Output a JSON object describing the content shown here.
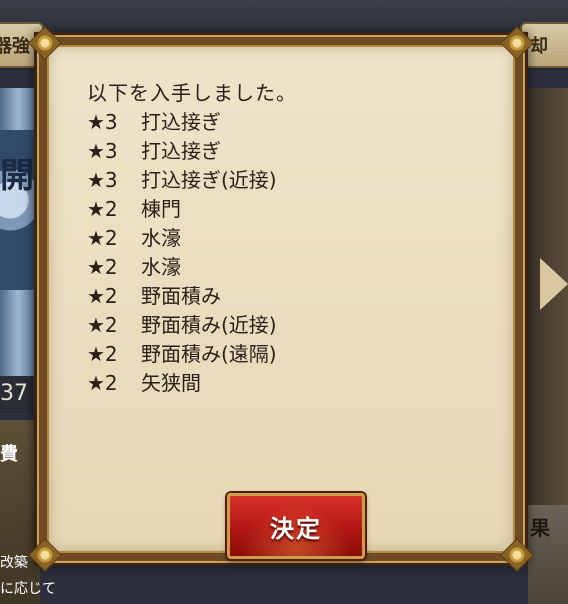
{
  "background": {
    "top_left_tab": "器強",
    "top_right_tab": "却",
    "left_glyph": "開",
    "left_number": "37",
    "left_text_1": "費",
    "left_text_2": "改築",
    "left_text_3": "に応じて",
    "right_text": "果"
  },
  "dialog": {
    "message": "以下を入手しました。",
    "items": [
      {
        "rarity": "★3",
        "name": "打込接ぎ"
      },
      {
        "rarity": "★3",
        "name": "打込接ぎ"
      },
      {
        "rarity": "★3",
        "name": "打込接ぎ(近接)"
      },
      {
        "rarity": "★2",
        "name": "棟門"
      },
      {
        "rarity": "★2",
        "name": "水濠"
      },
      {
        "rarity": "★2",
        "name": "水濠"
      },
      {
        "rarity": "★2",
        "name": "野面積み"
      },
      {
        "rarity": "★2",
        "name": "野面積み(近接)"
      },
      {
        "rarity": "★2",
        "name": "野面積み(遠隔)"
      },
      {
        "rarity": "★2",
        "name": "矢狭間"
      }
    ],
    "confirm_label": "決定"
  },
  "colors": {
    "frame": "#6e4b22",
    "parchment": "#efe4c9",
    "button_red": "#b11512",
    "gold_trim": "#c9a04a"
  }
}
